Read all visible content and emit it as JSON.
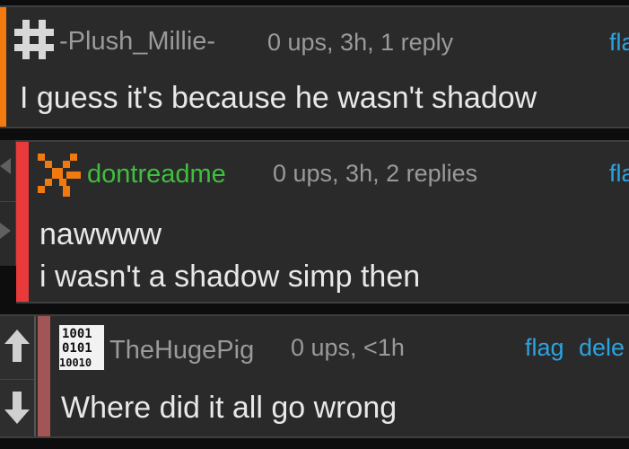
{
  "comments": [
    {
      "username": "-Plush_Millie-",
      "meta": "0 ups, 3h, 1 reply",
      "flag_label": "fla",
      "body_lines": [
        "I guess it's because he wasn't shadow"
      ],
      "avatar_icon": "hash-icon",
      "stripe_color": "#f27a0e",
      "username_color": "#9a9a9a"
    },
    {
      "username": "dontreadme",
      "meta": "0 ups, 3h, 2 replies",
      "flag_label": "fla",
      "body_lines": [
        "nawwww",
        "i wasn't a shadow simp then"
      ],
      "avatar_icon": "pixel-swirl-icon",
      "stripe_color": "#e83a3a",
      "username_color": "#3fbf3f"
    },
    {
      "username": "TheHugePig",
      "meta": "0 ups, <1h",
      "flag_label": "flag",
      "delete_label": "dele",
      "body_lines": [
        "Where did it all go wrong"
      ],
      "avatar_icon": "binary-icon",
      "avatar_text": [
        "1001",
        "0101",
        "10010"
      ],
      "stripe_color": "#a25555",
      "username_color": "#9a9a9a"
    }
  ],
  "vote_icons": [
    "upvote-arrow-icon",
    "downvote-arrow-icon"
  ],
  "link_color": "#2aa3e0"
}
